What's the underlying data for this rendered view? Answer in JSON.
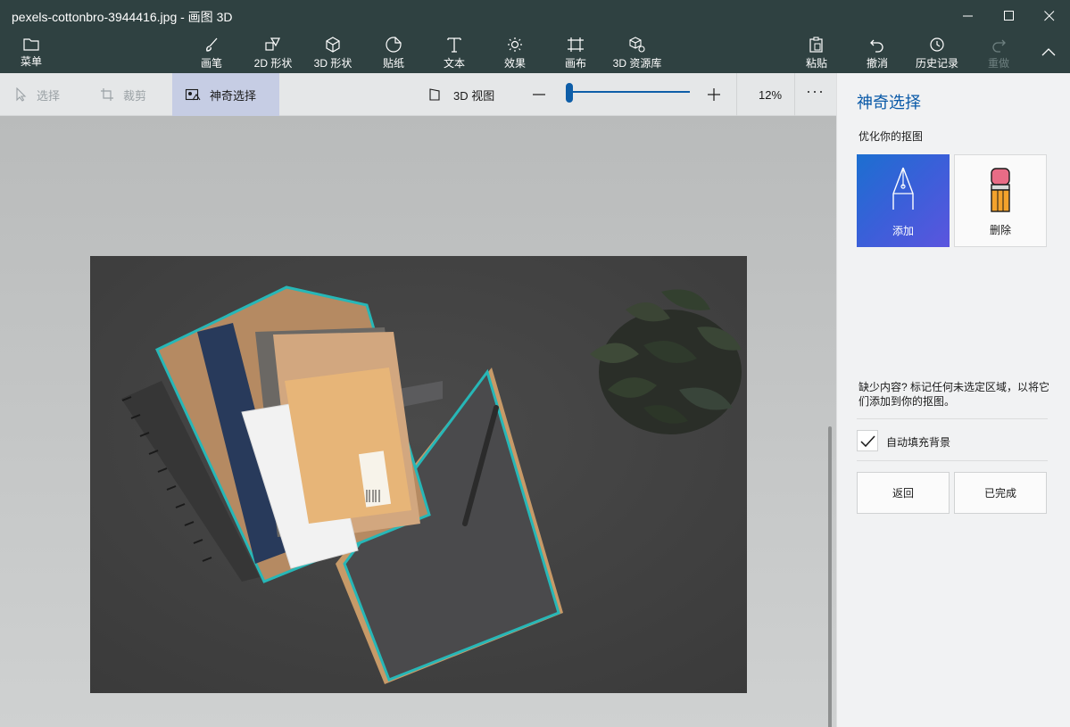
{
  "window": {
    "title": "pexels-cottonbro-3944416.jpg - 画图 3D"
  },
  "ribbon": {
    "menu": "菜单",
    "brush": "画笔",
    "shapes2d": "2D 形状",
    "shapes3d": "3D 形状",
    "stickers": "贴纸",
    "text": "文本",
    "effects": "效果",
    "canvas": "画布",
    "library3d": "3D 资源库",
    "paste": "粘贴",
    "undo": "撤消",
    "history": "历史记录",
    "redo": "重做"
  },
  "subbar": {
    "select": "选择",
    "crop": "裁剪",
    "magic_select": "神奇选择",
    "view3d": "3D 视图",
    "zoom_level": 0.02,
    "zoom": "12%",
    "more": "···"
  },
  "panel": {
    "title": "神奇选择",
    "subtitle": "优化你的抠图",
    "add": "添加",
    "remove": "删除",
    "hint": "缺少内容? 标记任何未选定区域，以将它们添加到你的抠图。",
    "autofill": "自动填充背景",
    "autofill_checked": true,
    "back": "返回",
    "done": "已完成"
  },
  "colors": {
    "titlebar": "#2f4141",
    "accent": "#0a5aa8",
    "selection_outline": "#27b7b7"
  }
}
